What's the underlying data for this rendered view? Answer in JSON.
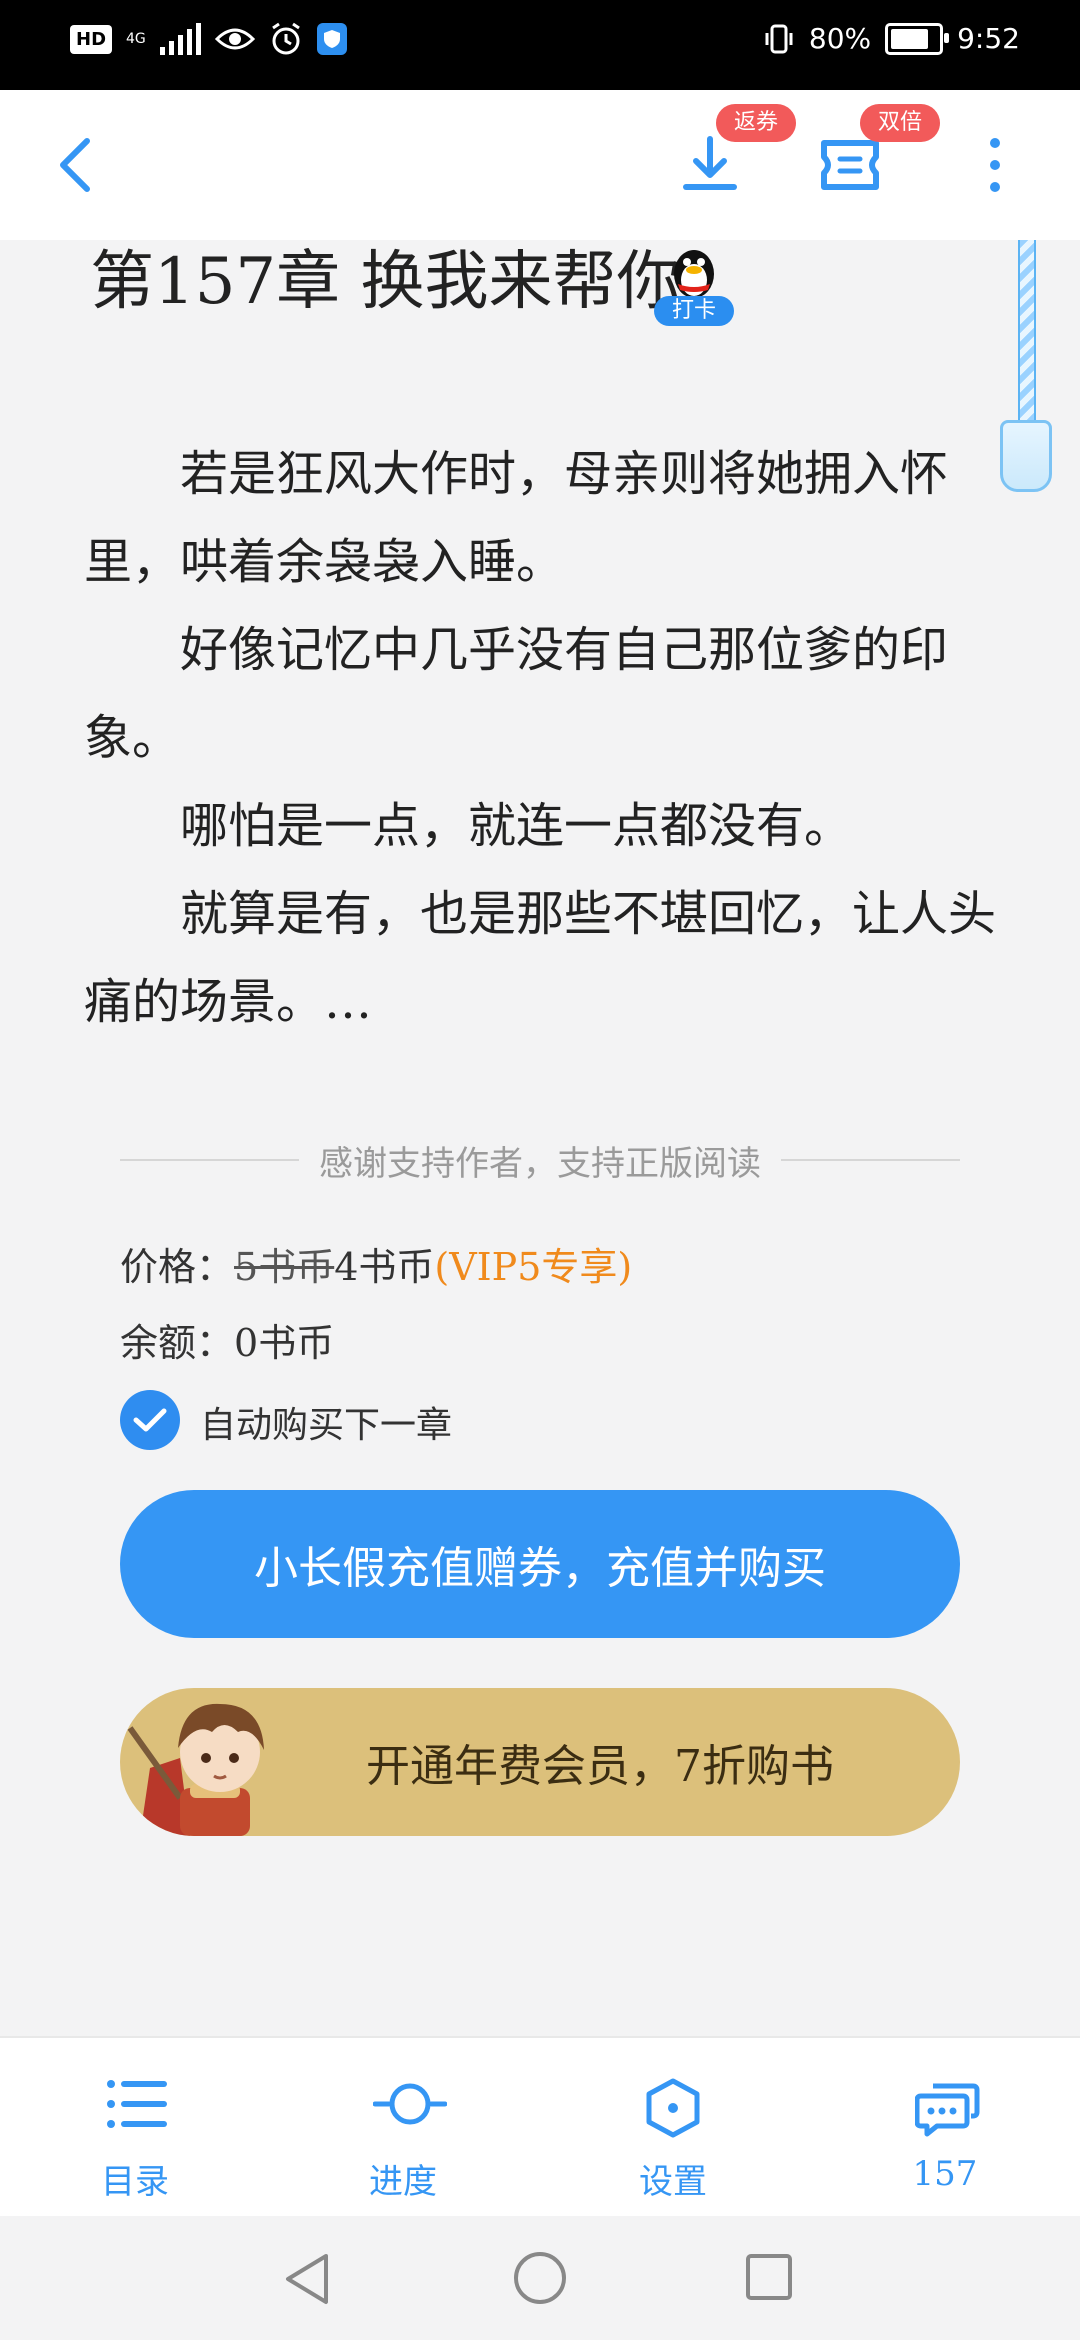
{
  "status_bar": {
    "hd": "HD",
    "network": "4G",
    "battery_text": "80%",
    "battery_level": 0.8,
    "time": "9:52"
  },
  "top_bar": {
    "download_badge": "返券",
    "ticket_badge": "双倍"
  },
  "chapter": {
    "title": "第157章 换我来帮你",
    "punch_label": "打卡"
  },
  "content": {
    "paragraphs": [
      "若是狂风大作时，母亲则将她拥入怀里，哄着余袅袅入睡。",
      "好像记忆中几乎没有自己那位爹的印象。",
      "哪怕是一点，就连一点都没有。",
      "就算是有，也是那些不堪回忆，让人头痛的场景。…"
    ]
  },
  "purchase": {
    "support_text": "感谢支持作者，支持正版阅读",
    "price_label": "价格：",
    "original_price": "5书币",
    "current_price": "4书币",
    "vip_note": "(VIP5专享)",
    "balance_label": "余额：",
    "balance_value": "0书币",
    "auto_buy_label": "自动购买下一章",
    "auto_buy_checked": true,
    "recharge_button": "小长假充值赠券，充值并购买",
    "member_button": "开通年费会员，7折购书"
  },
  "toolbar": {
    "items": [
      {
        "label": "目录",
        "icon": "list-icon"
      },
      {
        "label": "进度",
        "icon": "progress-icon"
      },
      {
        "label": "设置",
        "icon": "settings-icon"
      },
      {
        "label": "157",
        "icon": "comments-icon"
      }
    ]
  },
  "colors": {
    "accent": "#3596f4",
    "vip": "#f08a1c",
    "badge": "#f25a5a",
    "member": "#dcc07b"
  }
}
